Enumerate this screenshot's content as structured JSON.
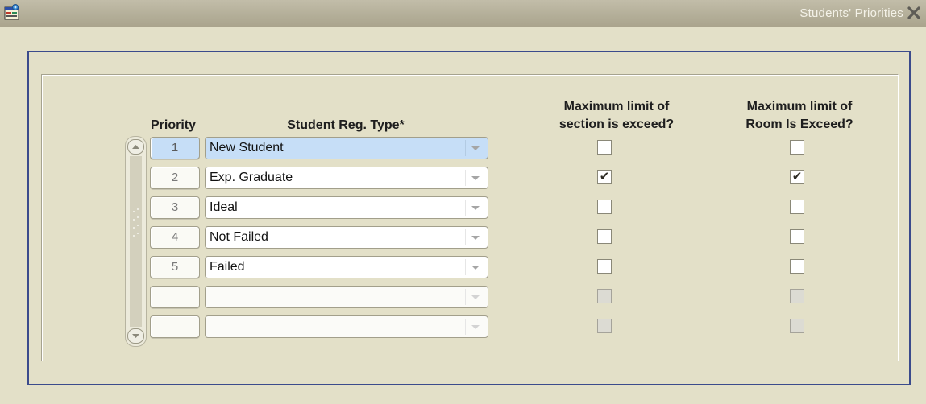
{
  "window": {
    "title": "Students' Priorities"
  },
  "headers": {
    "priority": "Priority",
    "reg_type": "Student Reg. Type*",
    "section_line1": "Maximum limit of",
    "section_line2": "section is exceed?",
    "room_line1": "Maximum limit of",
    "room_line2": "Room Is Exceed?"
  },
  "rows": [
    {
      "priority": "1",
      "reg_type": "New Student",
      "section_exceeded": false,
      "room_exceeded": false,
      "active": true,
      "enabled": true
    },
    {
      "priority": "2",
      "reg_type": "Exp. Graduate",
      "section_exceeded": true,
      "room_exceeded": true,
      "active": false,
      "enabled": true
    },
    {
      "priority": "3",
      "reg_type": "Ideal",
      "section_exceeded": false,
      "room_exceeded": false,
      "active": false,
      "enabled": true
    },
    {
      "priority": "4",
      "reg_type": "Not Failed",
      "section_exceeded": false,
      "room_exceeded": false,
      "active": false,
      "enabled": true
    },
    {
      "priority": "5",
      "reg_type": "Failed",
      "section_exceeded": false,
      "room_exceeded": false,
      "active": false,
      "enabled": true
    },
    {
      "priority": "",
      "reg_type": "",
      "section_exceeded": false,
      "room_exceeded": false,
      "active": false,
      "enabled": false
    },
    {
      "priority": "",
      "reg_type": "",
      "section_exceeded": false,
      "room_exceeded": false,
      "active": false,
      "enabled": false
    }
  ],
  "icons": {
    "app": "oracle-forms-app-icon",
    "close": "close-x-icon",
    "scroll_up": "scroll-up-arrow-icon",
    "scroll_down": "scroll-down-arrow-icon",
    "dropdown": "dropdown-arrow-icon",
    "check": "checkmark-icon"
  },
  "colors": {
    "background": "#e3e0c8",
    "frame_border": "#3b4b8c",
    "active_field": "#c6def7",
    "title_text": "#f4f2e8"
  }
}
